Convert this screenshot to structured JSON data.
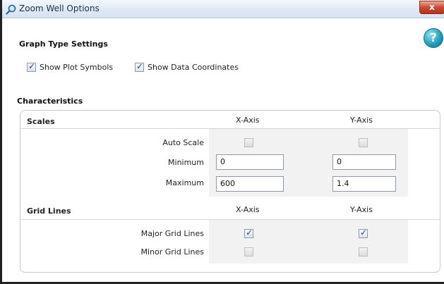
{
  "window": {
    "title": "Zoom Well Options",
    "close_label": "x",
    "help_label": "?"
  },
  "graph_type_settings": {
    "title": "Graph Type Settings",
    "show_plot_symbols": {
      "label": "Show Plot Symbols",
      "checked": true
    },
    "show_data_coordinates": {
      "label": "Show Data Coordinates",
      "checked": true
    }
  },
  "characteristics": {
    "title": "Characteristics",
    "scales": {
      "title": "Scales",
      "x_header": "X-Axis",
      "y_header": "Y-Axis",
      "auto_scale_label": "Auto Scale",
      "minimum_label": "Minimum",
      "maximum_label": "Maximum",
      "x_auto_scale": false,
      "y_auto_scale": false,
      "x_minimum": "0",
      "y_minimum": "0",
      "x_maximum": "600",
      "y_maximum": "1.4"
    },
    "grid_lines": {
      "title": "Grid Lines",
      "x_header": "X-Axis",
      "y_header": "Y-Axis",
      "major_label": "Major Grid Lines",
      "minor_label": "Minor Grid Lines",
      "x_major": true,
      "y_major": true,
      "x_minor": false,
      "y_minor": false
    }
  }
}
